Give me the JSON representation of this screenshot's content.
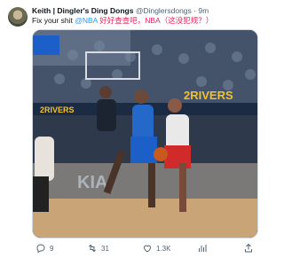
{
  "tweet": {
    "display_name": "Keith | Dingler's Ding Dongs",
    "handle": "@Dinglersdongs",
    "separator": "·",
    "time": "9m",
    "text_plain": "Fix your shit",
    "mention": "@NBA",
    "text_cn": "好好查查吧，NBA（这没犯规？）"
  },
  "media": {
    "banner_left": "2RIVERS",
    "banner_right": "2RIVERS",
    "court_logo": "KIA"
  },
  "actions": {
    "replies": "9",
    "retweets": "31",
    "likes": "1.3K",
    "views": ""
  },
  "icons": [
    "reply-icon",
    "retweet-icon",
    "like-icon",
    "views-icon",
    "share-icon"
  ],
  "colors": {
    "link_blue": "#1d9bf0",
    "chinese_text_red": "#e0245e",
    "meta_gray": "#536471"
  }
}
